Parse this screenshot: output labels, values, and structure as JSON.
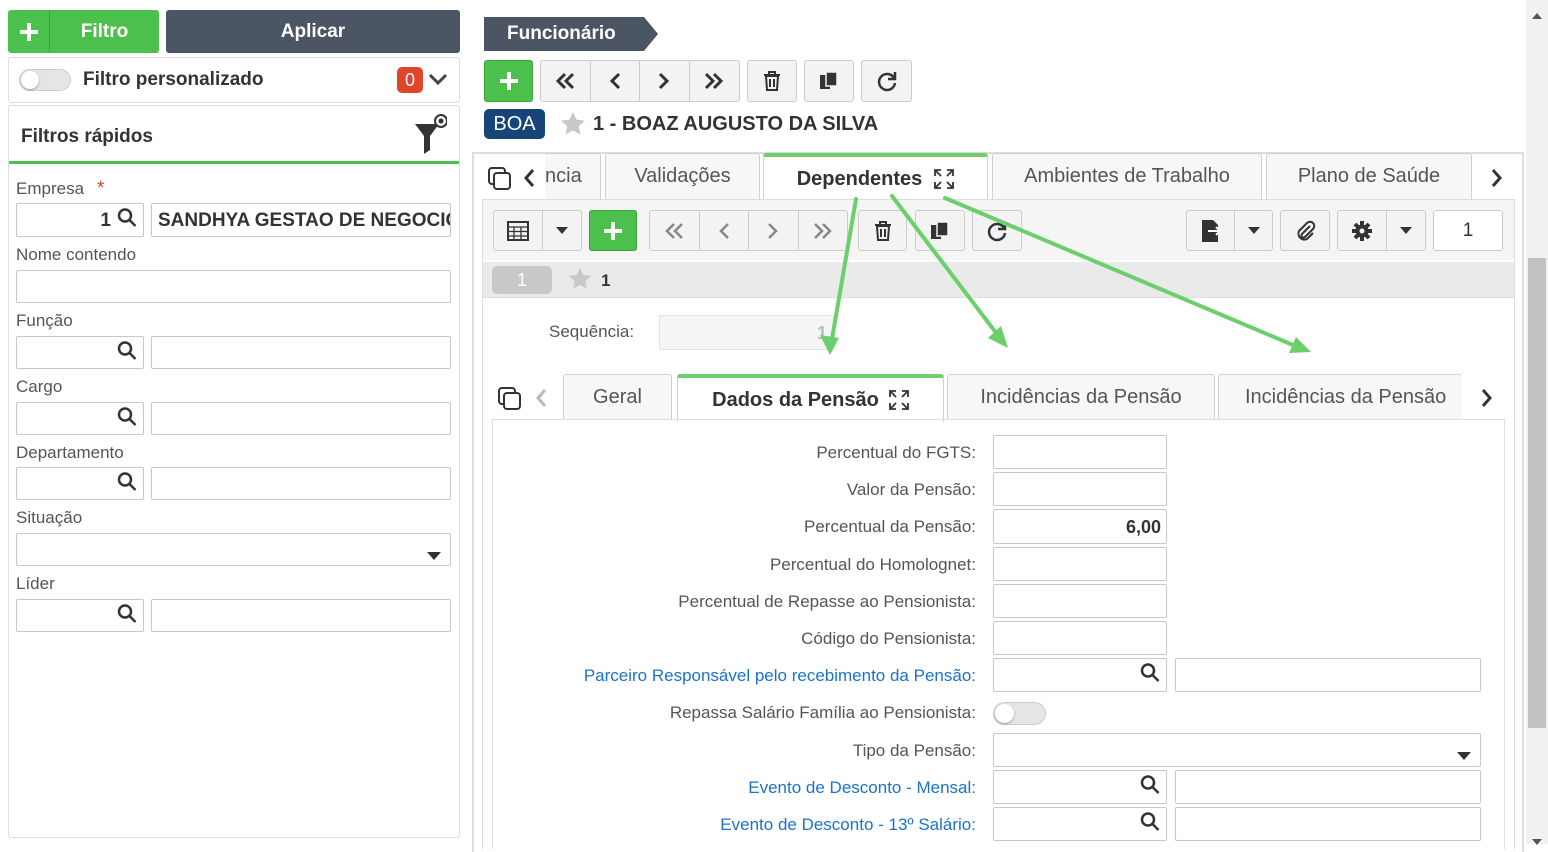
{
  "left": {
    "filter_button": "Filtro",
    "apply_button": "Aplicar",
    "custom_filter_label": "Filtro personalizado",
    "custom_filter_count": "0",
    "quick_filters_title": "Filtros rápidos",
    "fields": {
      "empresa_label": "Empresa",
      "required_mark": "*",
      "empresa_code": "1",
      "empresa_name": "SANDHYA GESTAO DE NEGOCIOS",
      "nome_label": "Nome contendo",
      "funcao_label": "Função",
      "cargo_label": "Cargo",
      "departamento_label": "Departamento",
      "situacao_label": "Situação",
      "lider_label": "Líder"
    }
  },
  "main": {
    "breadcrumb": "Funcionário",
    "record_badge": "BOA",
    "record_title": "1 - BOAZ AUGUSTO DA SILVA",
    "tabs": [
      {
        "label": "ncia"
      },
      {
        "label": "Validações"
      },
      {
        "label": "Dependentes"
      },
      {
        "label": "Ambientes de Trabalho"
      },
      {
        "label": "Plano de Saúde"
      }
    ],
    "dependentes": {
      "page_number": "1",
      "record_chip": "1",
      "record_label": "1",
      "sequencia_label": "Sequência:",
      "sequencia_value": "1",
      "subtabs": [
        {
          "label": "Geral"
        },
        {
          "label": "Dados da Pensão"
        },
        {
          "label": "Incidências da Pensão"
        },
        {
          "label": "Incidências da Pensão"
        }
      ],
      "form": {
        "percentual_fgts_label": "Percentual do FGTS:",
        "valor_pensao_label": "Valor da Pensão:",
        "percentual_pensao_label": "Percentual da Pensão:",
        "percentual_pensao_value": "6,00",
        "percentual_homolognet_label": "Percentual do Homolognet:",
        "percentual_repasse_label": "Percentual de Repasse ao Pensionista:",
        "codigo_pensionista_label": "Código do Pensionista:",
        "parceiro_label": "Parceiro Responsável pelo recebimento da Pensão:",
        "repassa_salario_label": "Repassa Salário Família ao Pensionista:",
        "tipo_pensao_label": "Tipo da Pensão:",
        "evento_mensal_label": "Evento de Desconto - Mensal:",
        "evento_13_label": "Evento de Desconto - 13º Salário:"
      }
    }
  },
  "colors": {
    "green": "#4cc04c",
    "dark": "#4b5563",
    "badge": "#17457a",
    "red_badge": "#e0442a",
    "link": "#1a73c9",
    "arrow": "#6ccf6c"
  }
}
